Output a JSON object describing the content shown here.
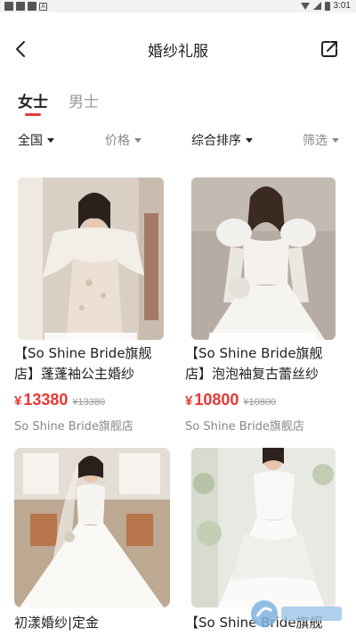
{
  "status_bar": {
    "time": "3:01"
  },
  "header": {
    "title": "婚纱礼服"
  },
  "tabs": [
    {
      "label": "女士",
      "active": true
    },
    {
      "label": "男士",
      "active": false
    }
  ],
  "filters": [
    {
      "label": "全国"
    },
    {
      "label": "价格"
    },
    {
      "label": "综合排序"
    },
    {
      "label": "筛选"
    }
  ],
  "products": [
    {
      "title": "【So Shine Bride旗舰店】蓬蓬袖公主婚纱",
      "price_symbol": "¥",
      "price": "13380",
      "original_price": "¥13380",
      "store": "So Shine Bride旗舰店"
    },
    {
      "title": "【So Shine Bride旗舰店】泡泡袖复古蕾丝纱",
      "price_symbol": "¥",
      "price": "10800",
      "original_price": "¥10800",
      "store": "So Shine Bride旗舰店"
    },
    {
      "title": "初漾婚纱|定金"
    },
    {
      "title": "【So Shine Bride旗舰"
    }
  ],
  "colors": {
    "accent": "#e53935",
    "muted": "#999999"
  }
}
